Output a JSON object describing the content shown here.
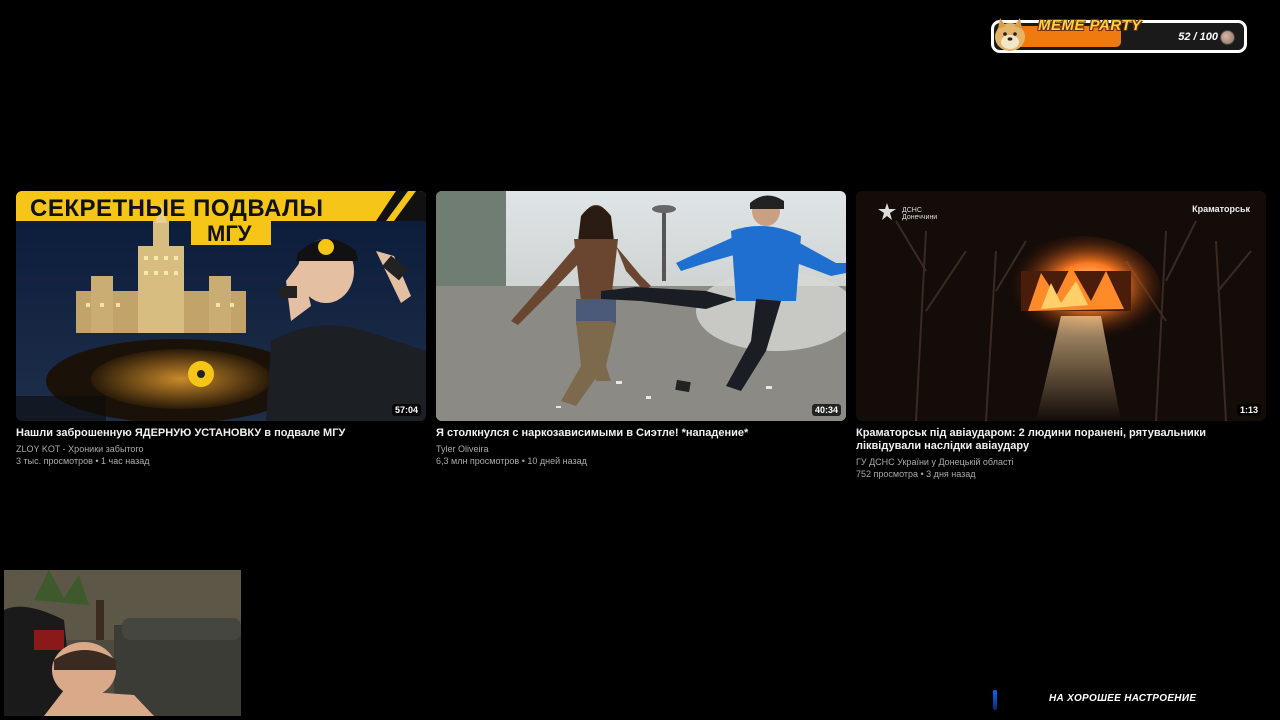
{
  "widget": {
    "title": "MEME PARTY",
    "count": "52 / 100",
    "progress": 0.52,
    "icon": "doge-icon",
    "bar_color": "#f07a10"
  },
  "videos": [
    {
      "thumb_title_line1": "СЕКРЕТНЫЕ ПОДВАЛЫ",
      "thumb_title_line2": "МГУ",
      "duration": "57:04",
      "title": "Нашли заброшенную ЯДЕРНУЮ УСТАНОВКУ в подвале МГУ",
      "channel": "ZLOY KOT - Хроники забытого",
      "meta": "3 тыс. просмотров • 1 час назад"
    },
    {
      "duration": "40:34",
      "title": "Я столкнулся с наркозависимыми в Сиэтле! *нападение*",
      "channel": "Tyler Oliveira",
      "meta": "6,3 млн просмотров • 10 дней назад"
    },
    {
      "thumb_logo": "ДСНС Донеччини",
      "thumb_location": "Краматорськ",
      "duration": "1:13",
      "title": "Краматорськ під авіаударом: 2 людини поранені, рятувальники ліквідували наслідки авіаудару",
      "channel": "ГУ ДСНС України у Донецькій області",
      "meta": "752 просмотра • 3 дня назад"
    }
  ],
  "footer": {
    "text": "НА ХОРОШЕЕ НАСТРОЕНИЕ"
  }
}
